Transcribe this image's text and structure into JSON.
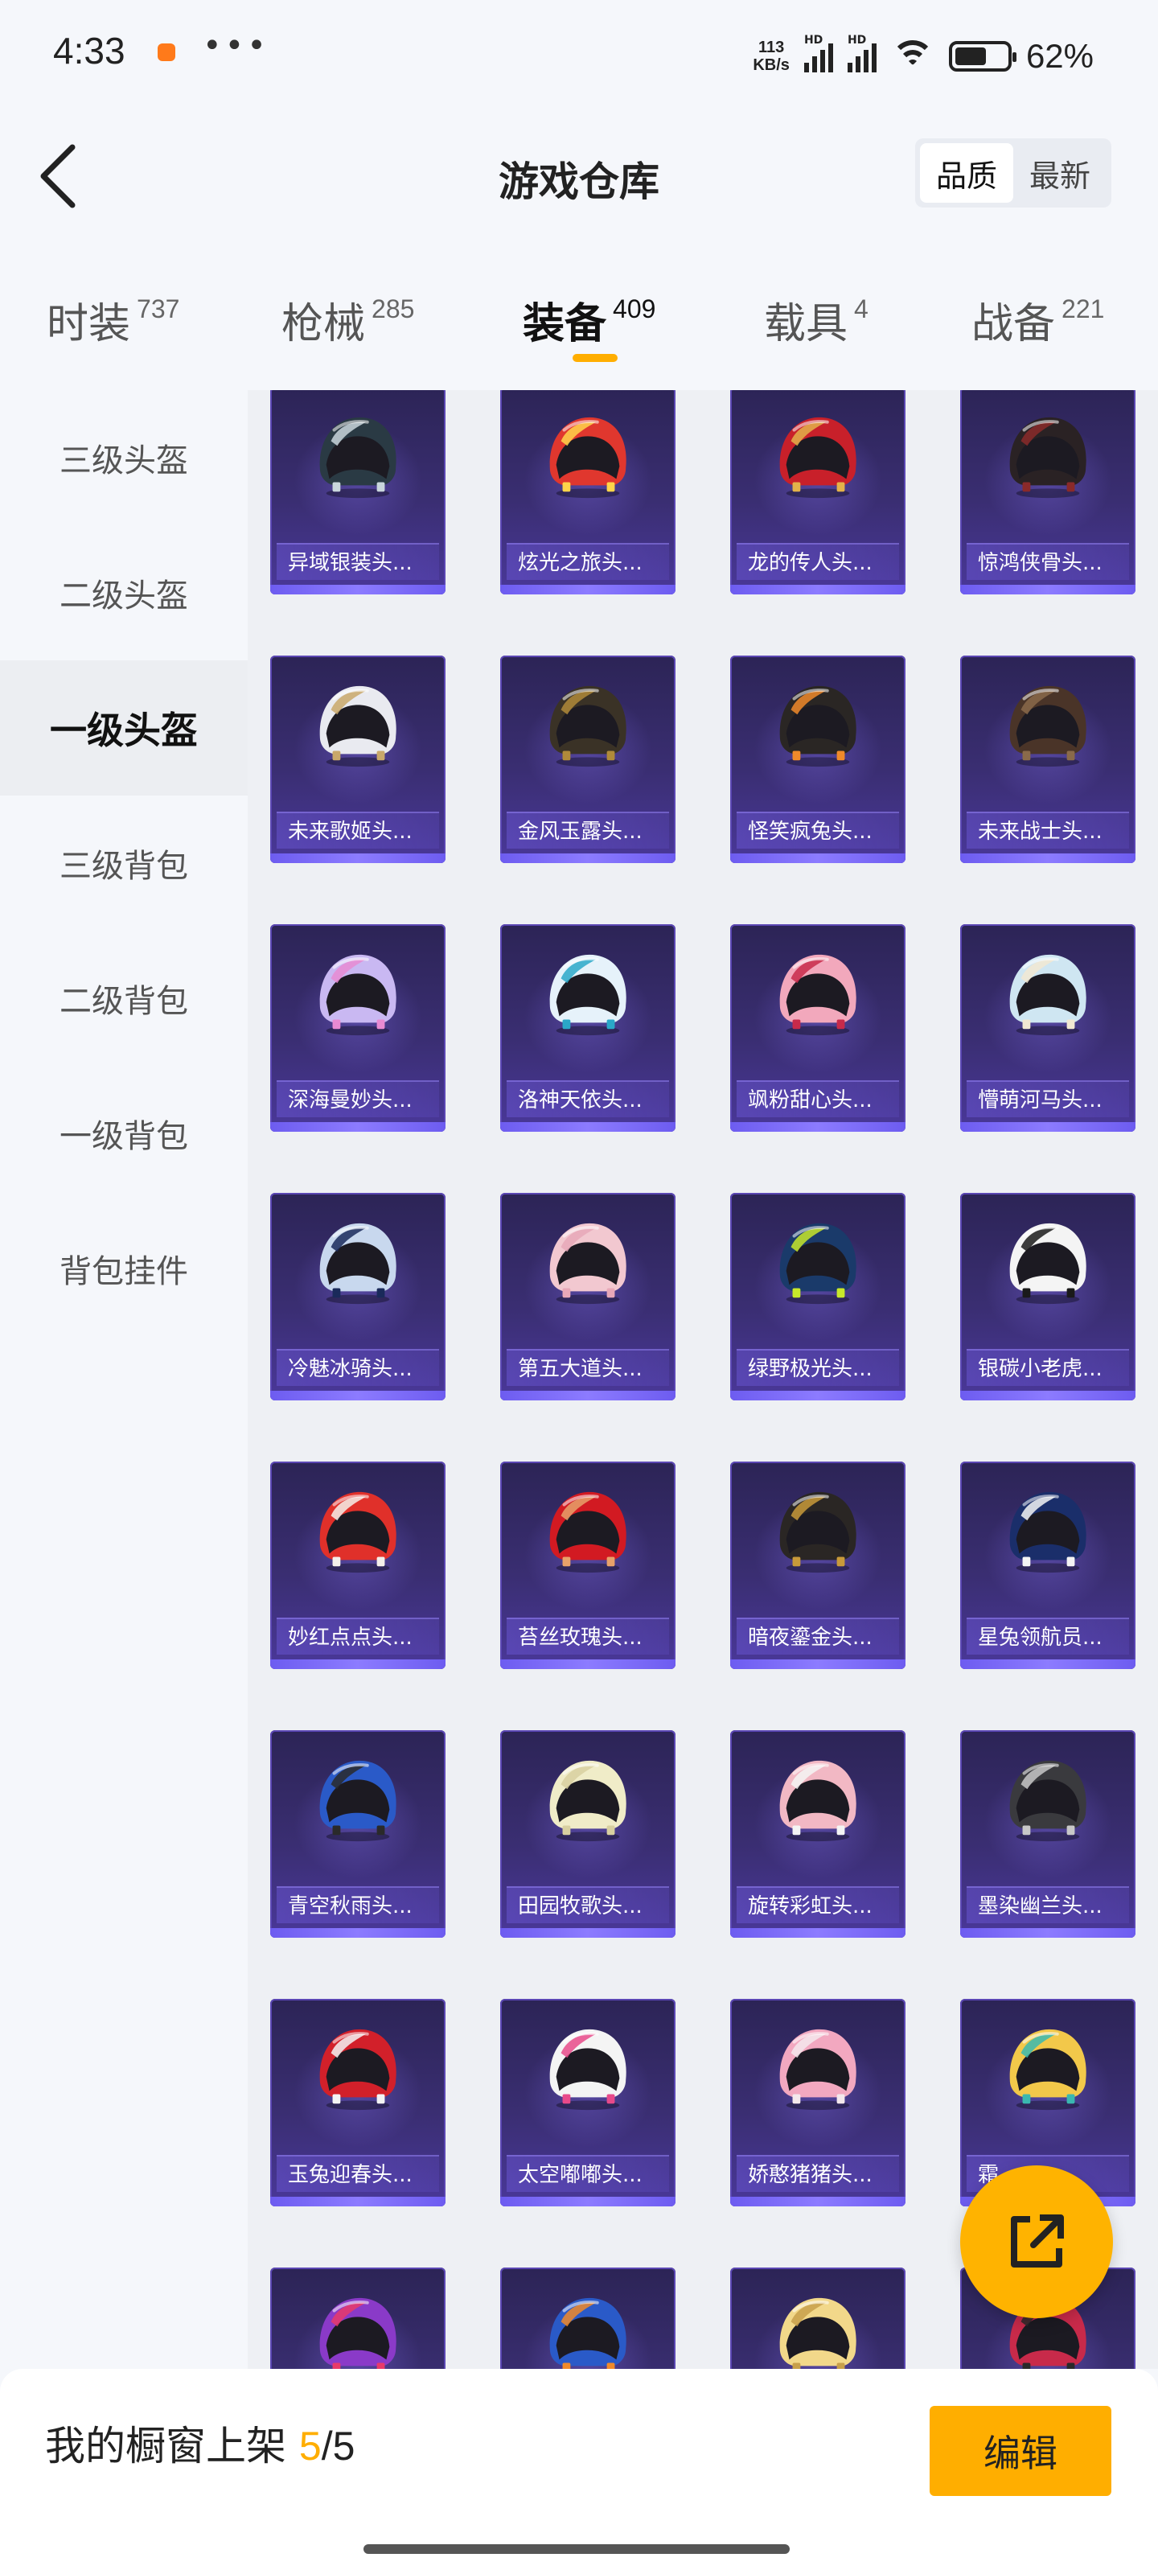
{
  "status_bar": {
    "time": "4:33",
    "network_speed_value": "113",
    "network_speed_unit": "KB/s",
    "battery_percent": "62%",
    "battery_level": 0.62
  },
  "header": {
    "title": "游戏仓库",
    "sort_options": [
      "品质",
      "最新"
    ],
    "sort_active": "品质"
  },
  "tabs": [
    {
      "label": "时装",
      "count": "737"
    },
    {
      "label": "枪械",
      "count": "285"
    },
    {
      "label": "装备",
      "count": "409",
      "active": true
    },
    {
      "label": "载具",
      "count": "4"
    },
    {
      "label": "战备",
      "count": "221"
    }
  ],
  "sidebar": {
    "items": [
      "三级头盔",
      "二级头盔",
      "一级头盔",
      "三级背包",
      "二级背包",
      "一级背包",
      "背包挂件"
    ],
    "active": "一级头盔"
  },
  "items": [
    {
      "name": "异域银装头...",
      "color": "#2a3a44",
      "accent": "#c9d6dc"
    },
    {
      "name": "炫光之旅头...",
      "color": "#e0372e",
      "accent": "#ffd54a"
    },
    {
      "name": "龙的传人头...",
      "color": "#c8202a",
      "accent": "#e3b24a"
    },
    {
      "name": "惊鸿侠骨头...",
      "color": "#2a2224",
      "accent": "#8a2a2a"
    },
    {
      "name": "未来歌姬头...",
      "color": "#e9eaf0",
      "accent": "#c9a86a"
    },
    {
      "name": "金风玉露头...",
      "color": "#3a3226",
      "accent": "#b08a3a"
    },
    {
      "name": "怪笑疯兔头...",
      "color": "#2a2624",
      "accent": "#f08a2a"
    },
    {
      "name": "未来战士头...",
      "color": "#4a3428",
      "accent": "#8a6a4a"
    },
    {
      "name": "深海曼妙头...",
      "color": "#c9b8f2",
      "accent": "#e88ad2"
    },
    {
      "name": "洛神天依头...",
      "color": "#e6f2fa",
      "accent": "#2aa8c8"
    },
    {
      "name": "飒粉甜心头...",
      "color": "#f2a8bc",
      "accent": "#c82a4a"
    },
    {
      "name": "懵萌河马头...",
      "color": "#cfe6f2",
      "accent": "#f2e8d2"
    },
    {
      "name": "冷魅冰骑头...",
      "color": "#c8d8ee",
      "accent": "#1a2a5a"
    },
    {
      "name": "第五大道头...",
      "color": "#f2c8d0",
      "accent": "#e8a8b8"
    },
    {
      "name": "绿野极光头...",
      "color": "#1a3a6a",
      "accent": "#c8e82a"
    },
    {
      "name": "银碳小老虎...",
      "color": "#f4f4f4",
      "accent": "#1a1a1a"
    },
    {
      "name": "妙红点点头...",
      "color": "#e0302a",
      "accent": "#f4f0ea"
    },
    {
      "name": "苔丝玫瑰头...",
      "color": "#d21a22",
      "accent": "#e8a26a"
    },
    {
      "name": "暗夜鎏金头...",
      "color": "#2a2624",
      "accent": "#c89a3a"
    },
    {
      "name": "星兔领航员...",
      "color": "#1a2e6a",
      "accent": "#f4f4f4"
    },
    {
      "name": "青空秋雨头...",
      "color": "#2a5ac8",
      "accent": "#2a2a2a"
    },
    {
      "name": "田园牧歌头...",
      "color": "#f0ecc8",
      "accent": "#d8d0a0"
    },
    {
      "name": "旋转彩虹头...",
      "color": "#f2b8c4",
      "accent": "#f4f4f4"
    },
    {
      "name": "墨染幽兰头...",
      "color": "#3a3a3e",
      "accent": "#c8c8c8"
    },
    {
      "name": "玉兔迎春头...",
      "color": "#d2202a",
      "accent": "#f4f4f4"
    },
    {
      "name": "太空嘟嘟头...",
      "color": "#f4f4f4",
      "accent": "#e84a8a"
    },
    {
      "name": "娇憨猪猪头...",
      "color": "#f2a8c0",
      "accent": "#f4e8ec"
    },
    {
      "name": "霜...",
      "color": "#f2c84a",
      "accent": "#3ab8b0"
    },
    {
      "name": "",
      "color": "#8a3ac8",
      "accent": "#e83a6a"
    },
    {
      "name": "",
      "color": "#2a5ac8",
      "accent": "#f08a2a"
    },
    {
      "name": "",
      "color": "#f2d88a",
      "accent": "#c8a04a"
    },
    {
      "name": "",
      "color": "#c82a4a",
      "accent": "#2a2a2a"
    }
  ],
  "bottom": {
    "shelf_label": "我的橱窗上架",
    "shelf_current": "5",
    "shelf_separator": "/",
    "shelf_total": "5",
    "edit_label": "编辑"
  },
  "colors": {
    "accent": "#ffae00",
    "card_bg": "#3a2e72"
  }
}
